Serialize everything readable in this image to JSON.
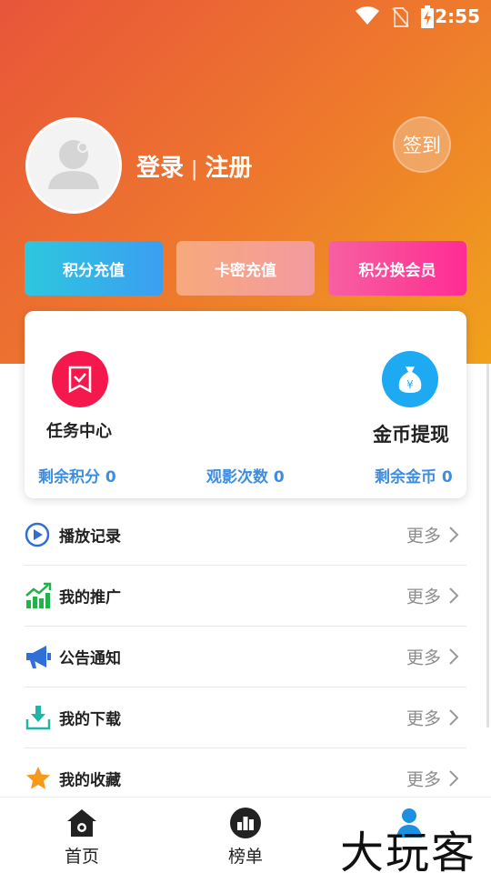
{
  "status_bar": {
    "time": "2:55",
    "icons": [
      "wifi-icon",
      "no-sim-icon",
      "battery-charging-icon"
    ]
  },
  "profile": {
    "login": "登录",
    "separator": "|",
    "register": "注册",
    "signin_button": "签到",
    "avatar_icon": "default-avatar-icon"
  },
  "actions": [
    {
      "label": "积分充值",
      "color": "#3ba8ec"
    },
    {
      "label": "卡密充值",
      "color": "#f5a390"
    },
    {
      "label": "积分换会员",
      "color": "#fb4a9a"
    }
  ],
  "card": {
    "task_center": {
      "label": "任务中心",
      "icon": "task-check-icon",
      "color": "#f5184d"
    },
    "coin_withdraw": {
      "label": "金币提现",
      "icon": "money-bag-icon",
      "color": "#1daaf3"
    },
    "stats": [
      {
        "label": "剩余积分 0"
      },
      {
        "label": "观影次数 0"
      },
      {
        "label": "剩余金币 0"
      }
    ],
    "stat_color": "#3d8de0"
  },
  "menu": {
    "more_label": "更多",
    "items": [
      {
        "label": "播放记录",
        "icon": "play-icon"
      },
      {
        "label": "我的推广",
        "icon": "growth-chart-icon"
      },
      {
        "label": "公告通知",
        "icon": "megaphone-icon"
      },
      {
        "label": "我的下载",
        "icon": "download-icon"
      },
      {
        "label": "我的收藏",
        "icon": "star-icon"
      }
    ]
  },
  "tabbar": {
    "tabs": [
      {
        "label": "首页",
        "icon": "home-icon"
      },
      {
        "label": "榜单",
        "icon": "ranking-icon"
      },
      {
        "label": "",
        "icon": "user-icon"
      }
    ]
  },
  "watermark": "大玩客",
  "theme": {
    "hero_gradient_start": "#e8553a",
    "hero_gradient_end": "#f0a21c"
  }
}
